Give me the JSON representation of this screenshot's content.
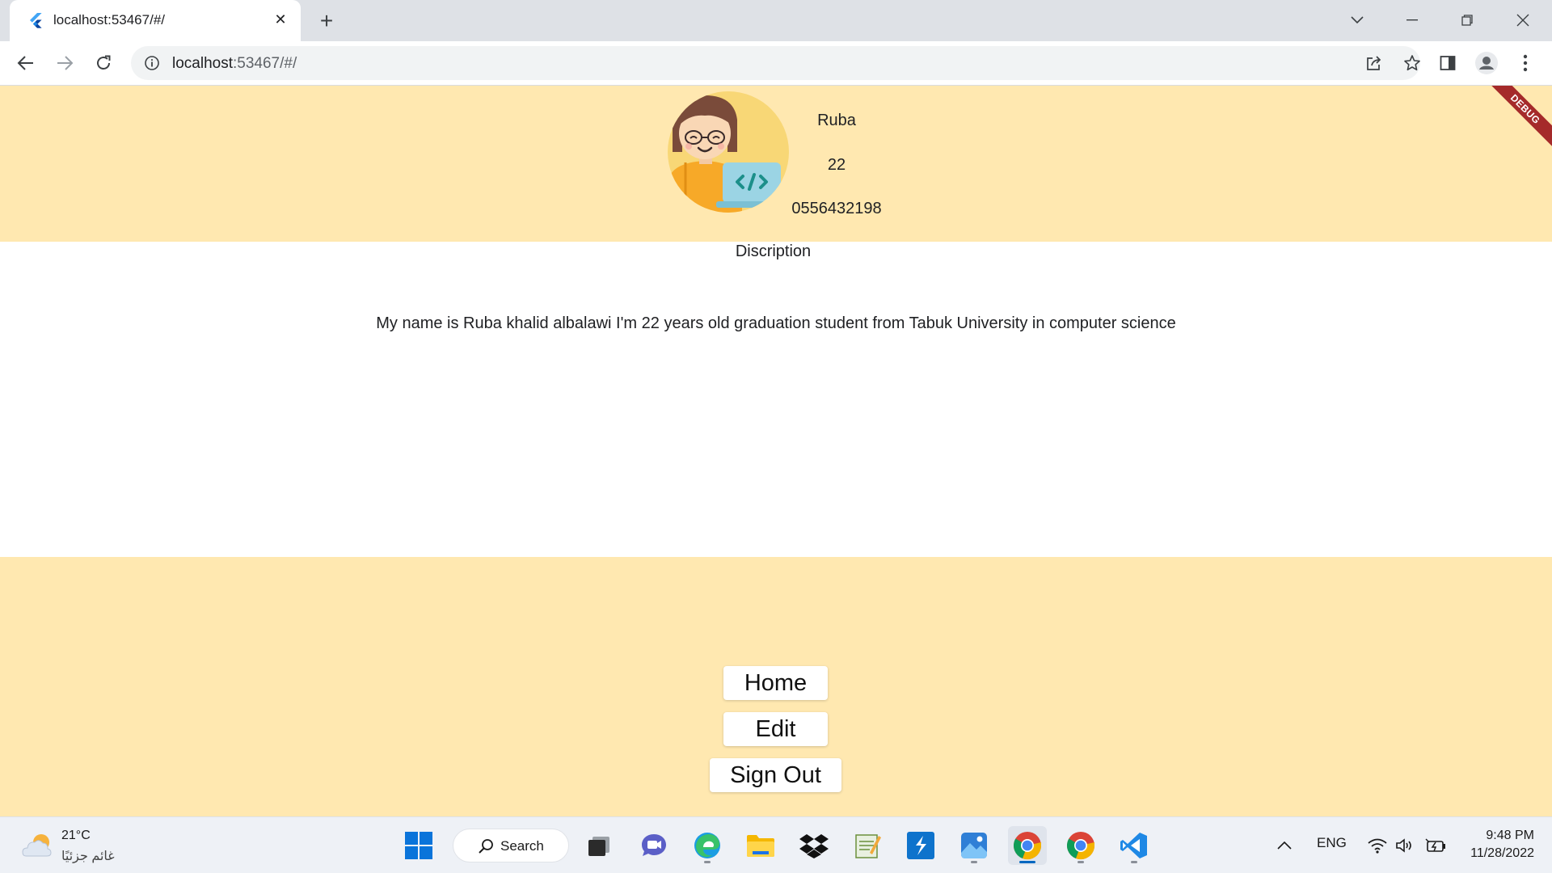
{
  "browser": {
    "tab_title": "localhost:53467/#/",
    "url_host": "localhost",
    "url_rest": ":53467/#/"
  },
  "profile": {
    "name": "Ruba",
    "age": "22",
    "phone": "0556432198",
    "description_label": "Discription",
    "description": "My name is Ruba khalid albalawi I'm 22 years old graduation student from Tabuk University in computer science"
  },
  "buttons": {
    "home": "Home",
    "edit": "Edit",
    "sign_out": "Sign Out"
  },
  "debug_banner": "DEBUG",
  "taskbar": {
    "weather_temp": "21°C",
    "weather_desc": "غائم جزئيًا",
    "search_label": "Search",
    "language": "ENG",
    "time": "9:48 PM",
    "date": "11/28/2022"
  },
  "colors": {
    "page_band": "#ffe8b0",
    "debug_banner": "#a52a2a"
  }
}
